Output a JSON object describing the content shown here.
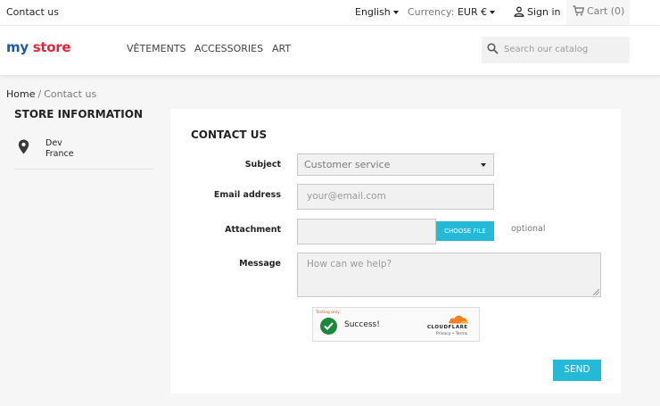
{
  "topbar": {
    "contact_link": "Contact us",
    "language": "English",
    "currency_label": "Currency:",
    "currency_value": "EUR €",
    "signin": "Sign in",
    "cart": "Cart (0)"
  },
  "header": {
    "logo_parts": [
      "my",
      " ",
      "store"
    ],
    "nav": [
      "VÊTEMENTS",
      "ACCESSORIES",
      "ART"
    ],
    "search_placeholder": "Search our catalog"
  },
  "breadcrumb": {
    "home": "Home",
    "separator": "/",
    "current": "Contact us"
  },
  "store_info": {
    "title": "STORE INFORMATION",
    "lines": [
      "Dev",
      "France"
    ]
  },
  "form": {
    "title": "CONTACT US",
    "subject_label": "Subject",
    "subject_value": "Customer service",
    "email_label": "Email address",
    "email_placeholder": "your@email.com",
    "attachment_label": "Attachment",
    "choose_file": "CHOOSE FILE",
    "optional": "optional",
    "message_label": "Message",
    "message_placeholder": "How can we help?",
    "send": "SEND"
  },
  "captcha": {
    "testing": "Testing only.",
    "status": "Success!",
    "brand": "CLOUDFLARE",
    "links": "Privacy • Terms"
  },
  "colors": {
    "accent": "#24b9d7",
    "logo_m": "#1e5aa8",
    "logo_y": "#e3263c",
    "logo_s": "#1e5aa8",
    "success_green": "#1a8a3a",
    "cloudflare_orange": "#f38020"
  },
  "icons": [
    "user-icon",
    "cart-icon",
    "search-icon",
    "map-pin-icon",
    "check-icon",
    "cloudflare-icon",
    "resize-handle-icon"
  ]
}
